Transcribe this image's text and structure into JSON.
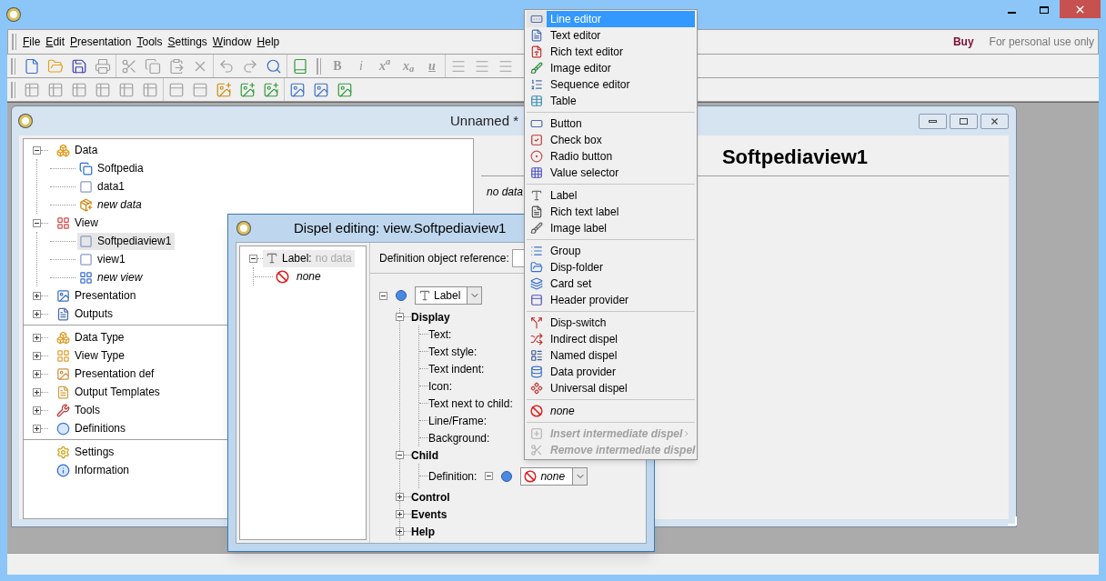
{
  "menu_bar": {
    "items": [
      "File",
      "Edit",
      "Presentation",
      "Tools",
      "Settings",
      "Window",
      "Help"
    ],
    "buy": "Buy",
    "license": "For personal use only"
  },
  "toolbar_rows": [
    [
      {
        "groups": [
          [
            {
              "disabled": false
            },
            {
              "disabled": false
            },
            {
              "disabled": false
            },
            {
              "disabled": true
            }
          ],
          [
            {
              "disabled": true
            },
            {
              "disabled": true
            },
            {
              "disabled": true
            },
            {
              "disabled": true
            }
          ],
          [
            {
              "disabled": true
            },
            {
              "disabled": true
            },
            {
              "disabled": false
            }
          ],
          [
            {
              "disabled": false
            }
          ]
        ]
      },
      {
        "groups": [
          [
            {
              "glyph": "B",
              "disabled": true
            },
            {
              "glyph": "i",
              "disabled": true
            },
            {
              "glyph": "x$^{a}$",
              "disabled": true
            },
            {
              "glyph": "x$_{a}$",
              "disabled": true
            },
            {
              "glyph": "u",
              "disabled": true
            }
          ],
          [
            {
              "disabled": true
            },
            {
              "disabled": true
            },
            {
              "disabled": true
            }
          ]
        ]
      }
    ],
    [
      {
        "groups": [
          [
            {
              "disabled": true
            },
            {
              "disabled": true
            },
            {
              "disabled": true
            },
            {
              "disabled": true
            },
            {
              "disabled": true
            },
            {
              "disabled": true
            }
          ],
          [
            {
              "disabled": true
            },
            {
              "disabled": true
            },
            {
              "disabled": false
            },
            {
              "disabled": false
            },
            {
              "disabled": false
            }
          ],
          [
            {
              "disabled": false
            },
            {
              "disabled": false
            },
            {
              "disabled": false
            }
          ]
        ]
      }
    ]
  ],
  "mdi_window": {
    "title": "Unnamed *",
    "tree": {
      "groups": [
        [
          {
            "label": "Data",
            "italic": false,
            "selected": false,
            "expanded": true,
            "children": [
              {
                "label": "Softpedia",
                "italic": false,
                "selected": false
              },
              {
                "label": "data1",
                "italic": false,
                "selected": false
              },
              {
                "label": "new data",
                "italic": true,
                "selected": false
              }
            ]
          },
          {
            "label": "View",
            "italic": false,
            "selected": false,
            "expanded": true,
            "children": [
              {
                "label": "Softpediaview1",
                "italic": false,
                "selected": true
              },
              {
                "label": "view1",
                "italic": false,
                "selected": false
              },
              {
                "label": "new view",
                "italic": true,
                "selected": false
              }
            ]
          },
          {
            "label": "Presentation",
            "italic": false,
            "selected": false,
            "expanded": false
          },
          {
            "label": "Outputs",
            "italic": false,
            "selected": false,
            "expanded": false
          }
        ],
        [
          {
            "label": "Data Type",
            "italic": false,
            "selected": false,
            "expanded": false
          },
          {
            "label": "View Type",
            "italic": false,
            "selected": false,
            "expanded": false
          },
          {
            "label": "Presentation def",
            "italic": false,
            "selected": false,
            "expanded": false
          },
          {
            "label": "Output Templates",
            "italic": false,
            "selected": false,
            "expanded": false
          },
          {
            "label": "Tools",
            "italic": false,
            "selected": false,
            "expanded": false
          },
          {
            "label": "Definitions",
            "italic": false,
            "selected": false,
            "expanded": false
          }
        ],
        [
          {
            "label": "Settings",
            "italic": false,
            "selected": false
          },
          {
            "label": "Information",
            "italic": false,
            "selected": false
          }
        ]
      ]
    },
    "view": {
      "heading": "Softpediaview1",
      "status": "no data"
    }
  },
  "dialog": {
    "title": "Dispel editing: view.Softpediaview1",
    "tree": [
      {
        "label": "Label:",
        "value": "no data",
        "selected": true,
        "expanded": true,
        "children": [
          {
            "label": "none"
          }
        ]
      }
    ],
    "reference_label": "Definition object reference:",
    "type_combo": "Label",
    "properties": [
      {
        "label": "Display",
        "expanded": true,
        "children": [
          {
            "label": "Text:"
          },
          {
            "label": "Text style:"
          },
          {
            "label": "Text indent:"
          },
          {
            "label": "Icon:"
          },
          {
            "label": "Text next to child:"
          },
          {
            "label": "Line/Frame:"
          },
          {
            "label": "Background:"
          }
        ]
      },
      {
        "label": "Child",
        "expanded": true,
        "children": [
          {
            "label": "Definition:",
            "combo": "none"
          }
        ]
      },
      {
        "label": "Control",
        "expanded": false
      },
      {
        "label": "Events",
        "expanded": false
      },
      {
        "label": "Help",
        "expanded": false
      }
    ]
  },
  "popup_menu": {
    "groups": [
      [
        {
          "label": "Line editor",
          "selected": true,
          "disabled": false,
          "italic": false,
          "submenu": false
        },
        {
          "label": "Text editor",
          "selected": false,
          "disabled": false,
          "italic": false,
          "submenu": false
        },
        {
          "label": "Rich text editor",
          "selected": false,
          "disabled": false,
          "italic": false,
          "submenu": false
        },
        {
          "label": "Image editor",
          "selected": false,
          "disabled": false,
          "italic": false,
          "submenu": false
        },
        {
          "label": "Sequence editor",
          "selected": false,
          "disabled": false,
          "italic": false,
          "submenu": false
        },
        {
          "label": "Table",
          "selected": false,
          "disabled": false,
          "italic": false,
          "submenu": false
        }
      ],
      [
        {
          "label": "Button",
          "selected": false,
          "disabled": false,
          "italic": false,
          "submenu": false
        },
        {
          "label": "Check box",
          "selected": false,
          "disabled": false,
          "italic": false,
          "submenu": false
        },
        {
          "label": "Radio button",
          "selected": false,
          "disabled": false,
          "italic": false,
          "submenu": false
        },
        {
          "label": "Value selector",
          "selected": false,
          "disabled": false,
          "italic": false,
          "submenu": false
        }
      ],
      [
        {
          "label": "Label",
          "selected": false,
          "disabled": false,
          "italic": false,
          "submenu": false
        },
        {
          "label": "Rich text label",
          "selected": false,
          "disabled": false,
          "italic": false,
          "submenu": false
        },
        {
          "label": "Image label",
          "selected": false,
          "disabled": false,
          "italic": false,
          "submenu": false
        }
      ],
      [
        {
          "label": "Group",
          "selected": false,
          "disabled": false,
          "italic": false,
          "submenu": false
        },
        {
          "label": "Disp-folder",
          "selected": false,
          "disabled": false,
          "italic": false,
          "submenu": false
        },
        {
          "label": "Card set",
          "selected": false,
          "disabled": false,
          "italic": false,
          "submenu": false
        },
        {
          "label": "Header provider",
          "selected": false,
          "disabled": false,
          "italic": false,
          "submenu": false
        }
      ],
      [
        {
          "label": "Disp-switch",
          "selected": false,
          "disabled": false,
          "italic": false,
          "submenu": false
        },
        {
          "label": "Indirect dispel",
          "selected": false,
          "disabled": false,
          "italic": false,
          "submenu": false
        },
        {
          "label": "Named dispel",
          "selected": false,
          "disabled": false,
          "italic": false,
          "submenu": false
        },
        {
          "label": "Data provider",
          "selected": false,
          "disabled": false,
          "italic": false,
          "submenu": false
        },
        {
          "label": "Universal dispel",
          "selected": false,
          "disabled": false,
          "italic": false,
          "submenu": false
        }
      ],
      [
        {
          "label": "none",
          "selected": false,
          "disabled": false,
          "italic": true,
          "submenu": false
        }
      ],
      [
        {
          "label": "Insert intermediate dispel",
          "selected": false,
          "disabled": true,
          "italic": true,
          "submenu": true
        },
        {
          "label": "Remove intermediate dispel",
          "selected": false,
          "disabled": true,
          "italic": true,
          "submenu": false
        }
      ]
    ]
  }
}
